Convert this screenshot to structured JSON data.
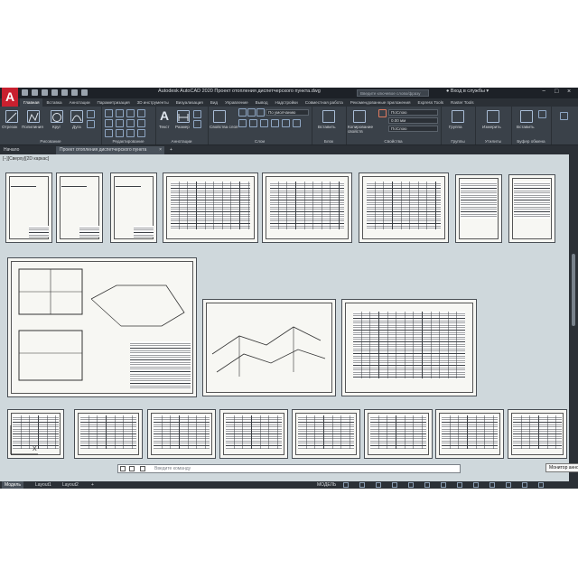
{
  "app": {
    "logo": "A",
    "window_title": "Autodesk AutoCAD 2020   Проект отопления диспетчерского пункта.dwg",
    "search_placeholder": "Введите ключевое слово/фразу",
    "sign_in": "Вход в службы",
    "window_controls": [
      "−",
      "□",
      "×"
    ]
  },
  "ribbon": {
    "tabs": [
      "Главная",
      "Вставка",
      "Аннотации",
      "Параметризация",
      "3D инструменты",
      "Визуализация",
      "Вид",
      "Управление",
      "Вывод",
      "Надстройки",
      "Совместная работа",
      "Рекомендованные приложения",
      "Express Tools",
      "Raster Tools"
    ],
    "active_tab": 0,
    "panels": [
      {
        "title": "Рисование",
        "tools": [
          "Отрезок",
          "Полилиния",
          "Круг",
          "Дуга"
        ]
      },
      {
        "title": "Редактирование"
      },
      {
        "title": "Аннотации",
        "tools": [
          "Текст",
          "Размер"
        ]
      },
      {
        "title": "Слои",
        "tools": [
          "Свойства слоя"
        ],
        "layer_combo": "По умолчанию"
      },
      {
        "title": "Блок",
        "tools": [
          "Вставить"
        ]
      },
      {
        "title": "Свойства",
        "tools": [
          "Копирование свойств"
        ],
        "combos": [
          "ПоСлою",
          "0.00 мм",
          "ПоСлою"
        ]
      },
      {
        "title": "Группы",
        "tools": [
          "Группа"
        ]
      },
      {
        "title": "Утилиты",
        "tools": [
          "Измерить"
        ]
      },
      {
        "title": "Буфер обмена",
        "tools": [
          "Вставить"
        ]
      }
    ]
  },
  "doc_tabs": [
    {
      "label": "Начало",
      "active": false
    },
    {
      "label": "Проект отопления диспетчерского пункта",
      "active": true
    },
    {
      "label": "+",
      "active": false
    }
  ],
  "viewport": {
    "label": "[−][Сверху][2D каркас]",
    "command_placeholder": "Введите команду",
    "tooltip": "Монитор аннот"
  },
  "status": {
    "tabs": [
      "Модель",
      "Layout1",
      "Layout2"
    ],
    "active_tab": 0,
    "model_label": "МОДЕЛЬ"
  }
}
